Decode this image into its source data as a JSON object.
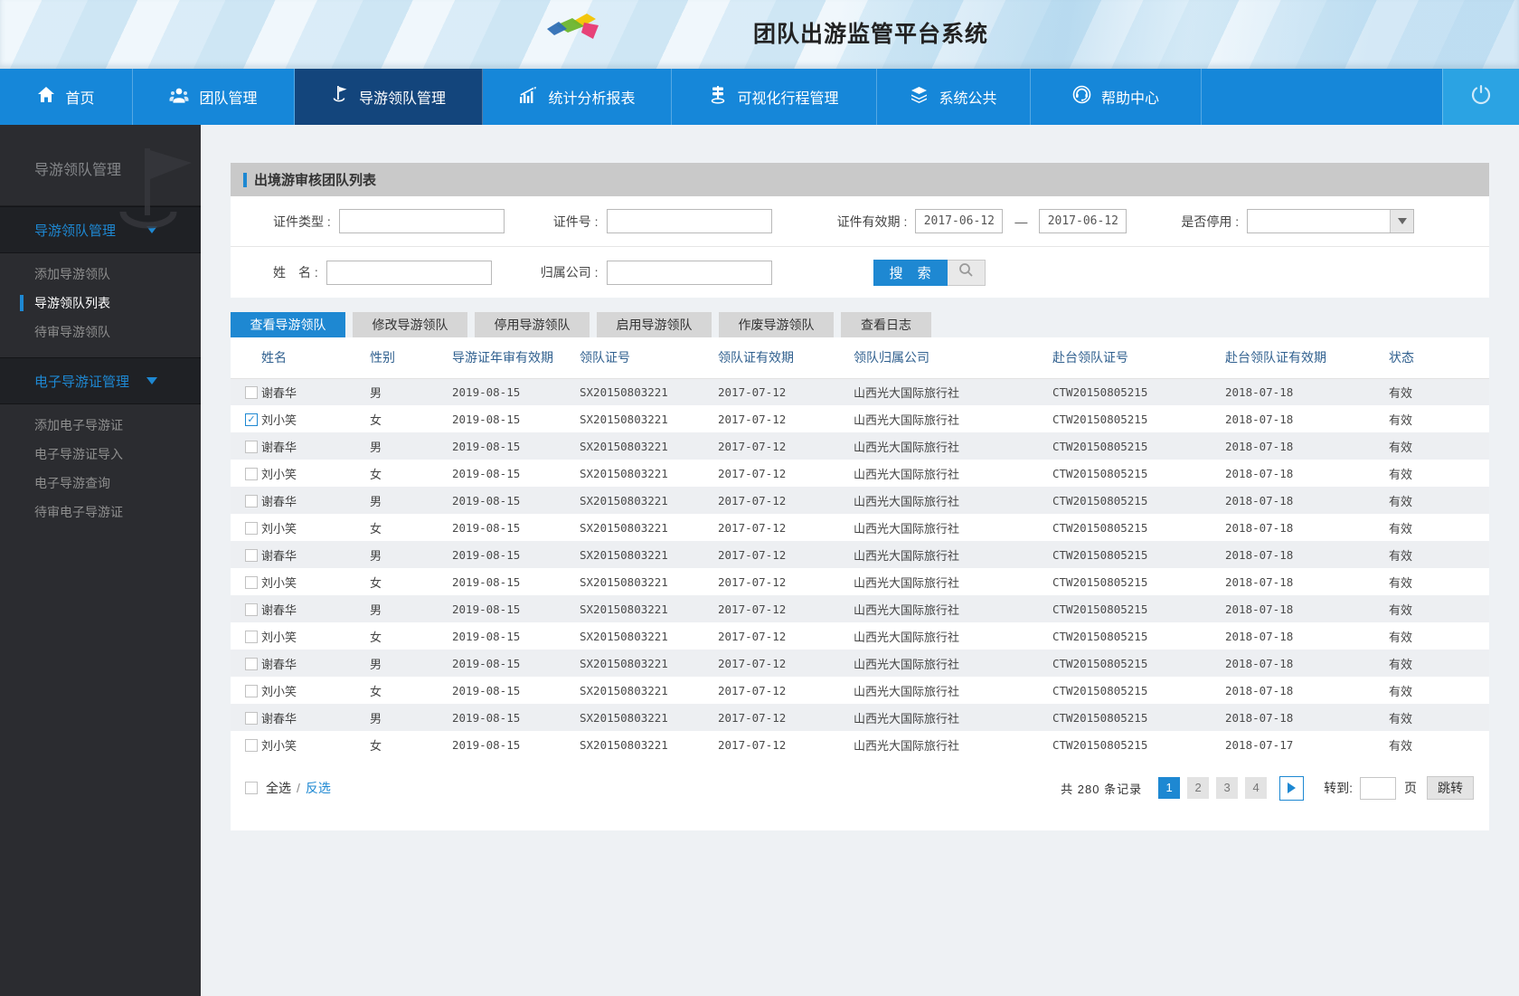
{
  "banner": {
    "title": "团队出游监管平台系统"
  },
  "nav": {
    "items": [
      {
        "label": "首页",
        "icon": "home-icon",
        "active": false
      },
      {
        "label": "团队管理",
        "icon": "team-icon",
        "active": false
      },
      {
        "label": "导游领队管理",
        "icon": "flag-icon",
        "active": true
      },
      {
        "label": "统计分析报表",
        "icon": "chart-icon",
        "active": false
      },
      {
        "label": "可视化行程管理",
        "icon": "signpost-icon",
        "active": false
      },
      {
        "label": "系统公共",
        "icon": "layers-icon",
        "active": false
      },
      {
        "label": "帮助中心",
        "icon": "headset-icon",
        "active": false
      }
    ],
    "logout_icon": "power-icon"
  },
  "sidebar": {
    "title": "导游领队管理",
    "groups": [
      {
        "label": "导游领队管理",
        "items": [
          {
            "label": "添加导游领队",
            "active": false
          },
          {
            "label": "导游领队列表",
            "active": true
          },
          {
            "label": "待审导游领队",
            "active": false
          }
        ]
      },
      {
        "label": "电子导游证管理",
        "items": [
          {
            "label": "添加电子导游证",
            "active": false
          },
          {
            "label": "电子导游证导入",
            "active": false
          },
          {
            "label": "电子导游查询",
            "active": false
          },
          {
            "label": "待审电子导游证",
            "active": false
          }
        ]
      }
    ]
  },
  "panel": {
    "title": "出境游审核团队列表",
    "form": {
      "cert_type_label": "证件类型 :",
      "cert_no_label": "证件号 :",
      "valid_label": "证件有效期 :",
      "date_from": "2017-06-12",
      "dash": "—",
      "date_to": "2017-06-12",
      "disabled_label": "是否停用 :",
      "name_label": "姓　名 :",
      "company_label": "归属公司 :",
      "search_label": "搜 索"
    },
    "tabs": [
      {
        "label": "查看导游领队",
        "active": true
      },
      {
        "label": "修改导游领队",
        "active": false
      },
      {
        "label": "停用导游领队",
        "active": false
      },
      {
        "label": "启用导游领队",
        "active": false
      },
      {
        "label": "作废导游领队",
        "active": false
      },
      {
        "label": "查看日志",
        "active": false
      }
    ],
    "table": {
      "columns": [
        "姓名",
        "性别",
        "导游证年审有效期",
        "领队证号",
        "领队证有效期",
        "领队归属公司",
        "赴台领队证号",
        "赴台领队证有效期",
        "状态"
      ],
      "rows": [
        {
          "checked": false,
          "name": "谢春华",
          "gender": "男",
          "review_valid": "2019-08-15",
          "leader_cert_no": "SX20150803221",
          "leader_cert_valid": "2017-07-12",
          "company": "山西光大国际旅行社",
          "taiwan_cert_no": "CTW20150805215",
          "taiwan_cert_valid": "2018-07-18",
          "status": "有效"
        },
        {
          "checked": true,
          "name": "刘小笑",
          "gender": "女",
          "review_valid": "2019-08-15",
          "leader_cert_no": "SX20150803221",
          "leader_cert_valid": "2017-07-12",
          "company": "山西光大国际旅行社",
          "taiwan_cert_no": "CTW20150805215",
          "taiwan_cert_valid": "2018-07-18",
          "status": "有效"
        },
        {
          "checked": false,
          "name": "谢春华",
          "gender": "男",
          "review_valid": "2019-08-15",
          "leader_cert_no": "SX20150803221",
          "leader_cert_valid": "2017-07-12",
          "company": "山西光大国际旅行社",
          "taiwan_cert_no": "CTW20150805215",
          "taiwan_cert_valid": "2018-07-18",
          "status": "有效"
        },
        {
          "checked": false,
          "name": "刘小笑",
          "gender": "女",
          "review_valid": "2019-08-15",
          "leader_cert_no": "SX20150803221",
          "leader_cert_valid": "2017-07-12",
          "company": "山西光大国际旅行社",
          "taiwan_cert_no": "CTW20150805215",
          "taiwan_cert_valid": "2018-07-18",
          "status": "有效"
        },
        {
          "checked": false,
          "name": "谢春华",
          "gender": "男",
          "review_valid": "2019-08-15",
          "leader_cert_no": "SX20150803221",
          "leader_cert_valid": "2017-07-12",
          "company": "山西光大国际旅行社",
          "taiwan_cert_no": "CTW20150805215",
          "taiwan_cert_valid": "2018-07-18",
          "status": "有效"
        },
        {
          "checked": false,
          "name": "刘小笑",
          "gender": "女",
          "review_valid": "2019-08-15",
          "leader_cert_no": "SX20150803221",
          "leader_cert_valid": "2017-07-12",
          "company": "山西光大国际旅行社",
          "taiwan_cert_no": "CTW20150805215",
          "taiwan_cert_valid": "2018-07-18",
          "status": "有效"
        },
        {
          "checked": false,
          "name": "谢春华",
          "gender": "男",
          "review_valid": "2019-08-15",
          "leader_cert_no": "SX20150803221",
          "leader_cert_valid": "2017-07-12",
          "company": "山西光大国际旅行社",
          "taiwan_cert_no": "CTW20150805215",
          "taiwan_cert_valid": "2018-07-18",
          "status": "有效"
        },
        {
          "checked": false,
          "name": "刘小笑",
          "gender": "女",
          "review_valid": "2019-08-15",
          "leader_cert_no": "SX20150803221",
          "leader_cert_valid": "2017-07-12",
          "company": "山西光大国际旅行社",
          "taiwan_cert_no": "CTW20150805215",
          "taiwan_cert_valid": "2018-07-18",
          "status": "有效"
        },
        {
          "checked": false,
          "name": "谢春华",
          "gender": "男",
          "review_valid": "2019-08-15",
          "leader_cert_no": "SX20150803221",
          "leader_cert_valid": "2017-07-12",
          "company": "山西光大国际旅行社",
          "taiwan_cert_no": "CTW20150805215",
          "taiwan_cert_valid": "2018-07-18",
          "status": "有效"
        },
        {
          "checked": false,
          "name": "刘小笑",
          "gender": "女",
          "review_valid": "2019-08-15",
          "leader_cert_no": "SX20150803221",
          "leader_cert_valid": "2017-07-12",
          "company": "山西光大国际旅行社",
          "taiwan_cert_no": "CTW20150805215",
          "taiwan_cert_valid": "2018-07-18",
          "status": "有效"
        },
        {
          "checked": false,
          "name": "谢春华",
          "gender": "男",
          "review_valid": "2019-08-15",
          "leader_cert_no": "SX20150803221",
          "leader_cert_valid": "2017-07-12",
          "company": "山西光大国际旅行社",
          "taiwan_cert_no": "CTW20150805215",
          "taiwan_cert_valid": "2018-07-18",
          "status": "有效"
        },
        {
          "checked": false,
          "name": "刘小笑",
          "gender": "女",
          "review_valid": "2019-08-15",
          "leader_cert_no": "SX20150803221",
          "leader_cert_valid": "2017-07-12",
          "company": "山西光大国际旅行社",
          "taiwan_cert_no": "CTW20150805215",
          "taiwan_cert_valid": "2018-07-18",
          "status": "有效"
        },
        {
          "checked": false,
          "name": "谢春华",
          "gender": "男",
          "review_valid": "2019-08-15",
          "leader_cert_no": "SX20150803221",
          "leader_cert_valid": "2017-07-12",
          "company": "山西光大国际旅行社",
          "taiwan_cert_no": "CTW20150805215",
          "taiwan_cert_valid": "2018-07-18",
          "status": "有效"
        },
        {
          "checked": false,
          "name": "刘小笑",
          "gender": "女",
          "review_valid": "2019-08-15",
          "leader_cert_no": "SX20150803221",
          "leader_cert_valid": "2017-07-12",
          "company": "山西光大国际旅行社",
          "taiwan_cert_no": "CTW20150805215",
          "taiwan_cert_valid": "2018-07-17",
          "status": "有效"
        }
      ]
    },
    "footer": {
      "select_all": "全选",
      "separator": "/",
      "invert": "反选",
      "total_prefix": "共",
      "total_count": "280",
      "total_suffix": "条记录",
      "pages": [
        "1",
        "2",
        "3",
        "4"
      ],
      "active_page": "1",
      "goto_label": "转到:",
      "page_unit": "页",
      "jump_label": "跳转"
    }
  },
  "colors": {
    "accent_blue": "#1e88d2",
    "nav_blue": "#1687d9",
    "nav_active": "#13457c",
    "power_blue": "#2ba3e3"
  }
}
